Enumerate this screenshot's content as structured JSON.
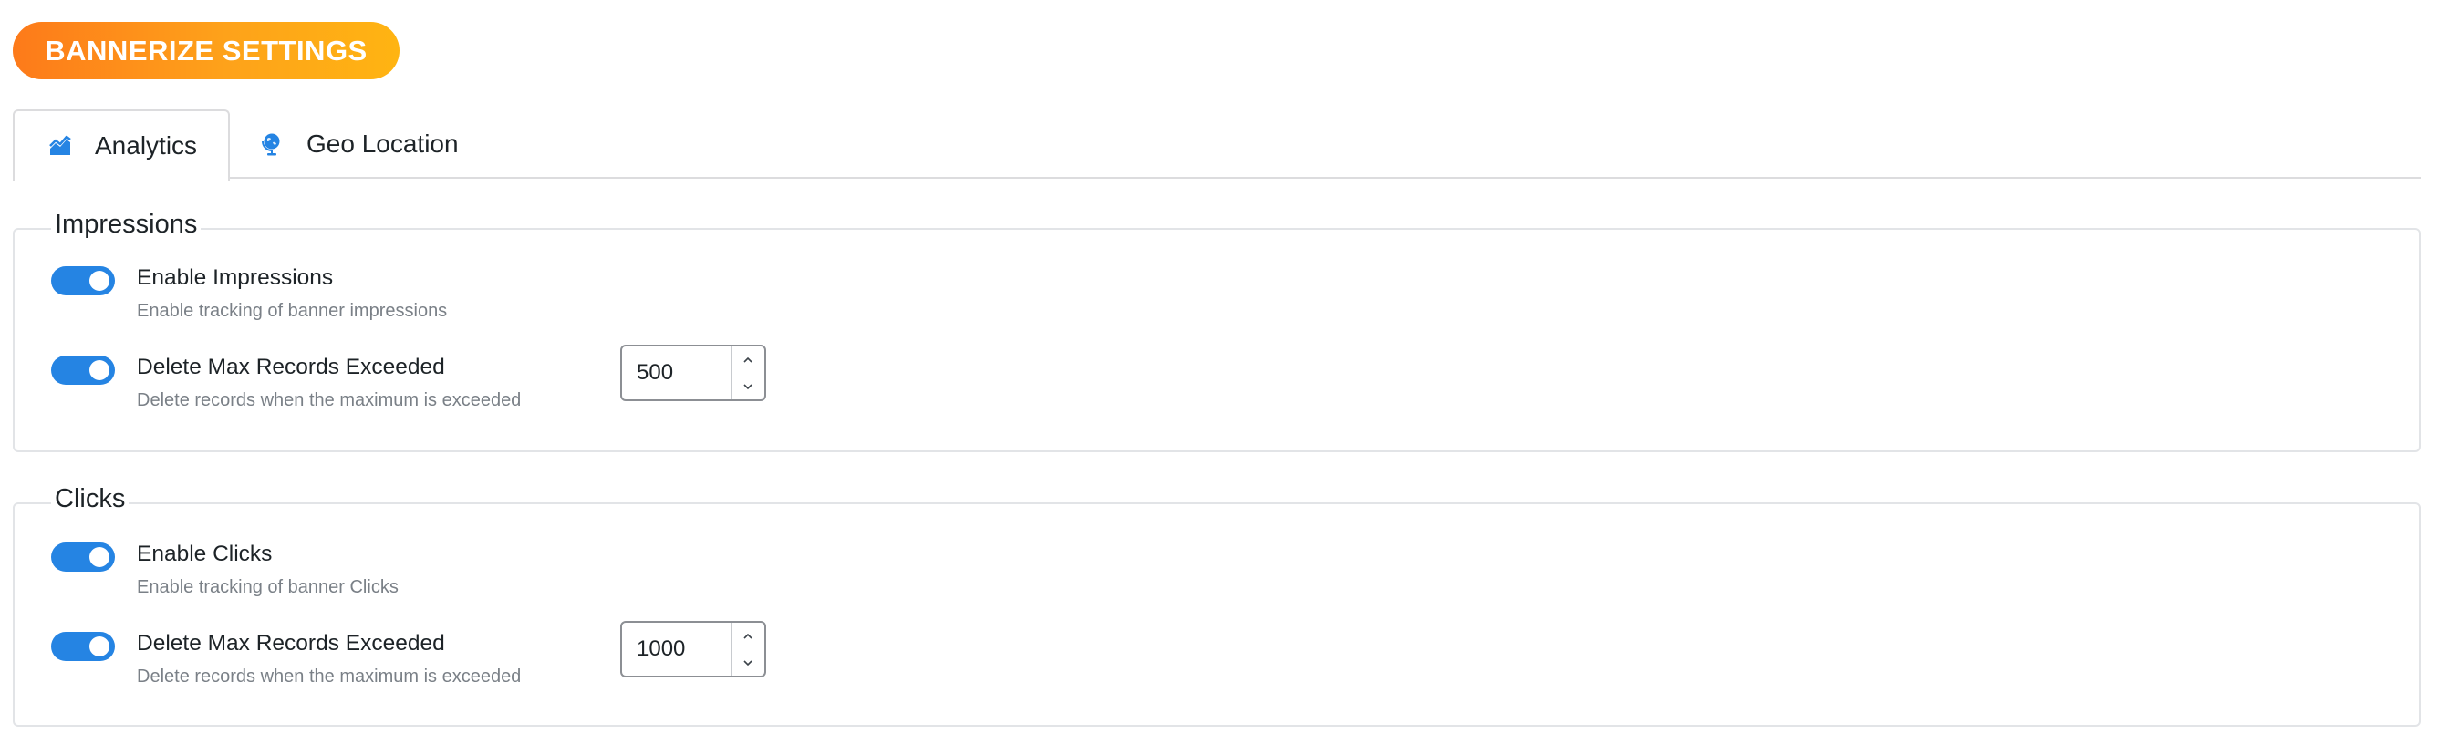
{
  "header": {
    "title": "BANNERIZE SETTINGS"
  },
  "tabs": [
    {
      "label": "Analytics",
      "icon": "area-chart-icon",
      "active": true
    },
    {
      "label": "Geo Location",
      "icon": "globe-icon",
      "active": false
    }
  ],
  "sections": {
    "impressions": {
      "legend": "Impressions",
      "enable": {
        "label": "Enable Impressions",
        "description": "Enable tracking of banner impressions",
        "checked": true
      },
      "delete_max": {
        "label": "Delete Max Records Exceeded",
        "description": "Delete records when the maximum is exceeded",
        "checked": true,
        "max_value": "500"
      }
    },
    "clicks": {
      "legend": "Clicks",
      "enable": {
        "label": "Enable Clicks",
        "description": "Enable tracking of banner Clicks",
        "checked": true
      },
      "delete_max": {
        "label": "Delete Max Records Exceeded",
        "description": "Delete records when the maximum is exceeded",
        "checked": true,
        "max_value": "1000"
      }
    }
  },
  "colors": {
    "accent": "#2584e3",
    "badge_gradient_start": "#fd7a1a",
    "badge_gradient_end": "#ffb412",
    "description_text": "#7a8087",
    "border": "#e2e4e7"
  }
}
